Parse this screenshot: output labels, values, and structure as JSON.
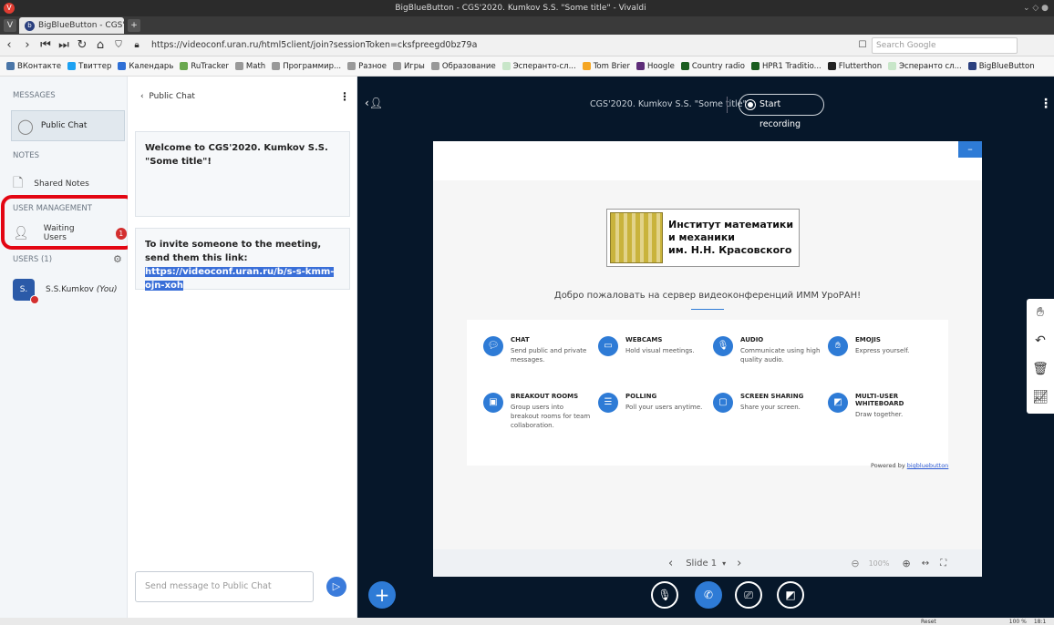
{
  "window": {
    "title": "BigBlueButton - CGS'2020. Kumkov S.S. \"Some title\" - Vivaldi"
  },
  "tabs": [
    {
      "label": "BigBlueButton - CGS'2020."
    }
  ],
  "address": {
    "url": "https://videoconf.uran.ru/html5client/join?sessionToken=cksfpreegd0bz79a",
    "search_placeholder": "Search Google"
  },
  "bookmarks": [
    {
      "label": "ВКонтакте",
      "color": "#4a76a8"
    },
    {
      "label": "Твиттер",
      "color": "#1da1f2"
    },
    {
      "label": "Календарь",
      "color": "#2e6fd6"
    },
    {
      "label": "RuTracker",
      "color": "#6aa84f"
    },
    {
      "label": "Math",
      "color": "#999999"
    },
    {
      "label": "Программир...",
      "color": "#999999"
    },
    {
      "label": "Разное",
      "color": "#999999"
    },
    {
      "label": "Игры",
      "color": "#999999"
    },
    {
      "label": "Образование",
      "color": "#999999"
    },
    {
      "label": "Эсперанто-сл...",
      "color": "#c8e6c9"
    },
    {
      "label": "Tom Brier",
      "color": "#f5a623"
    },
    {
      "label": "Hoogle",
      "color": "#5e2d79"
    },
    {
      "label": "Country radio",
      "color": "#1b5e20"
    },
    {
      "label": "HPR1 Traditio...",
      "color": "#1b5e20"
    },
    {
      "label": "Flutterthon",
      "color": "#222222"
    },
    {
      "label": "Эсперанто сл...",
      "color": "#c8e6c9"
    },
    {
      "label": "BigBlueButton",
      "color": "#2a3f7e"
    }
  ],
  "sidebar": {
    "messages_title": "MESSAGES",
    "public_chat": "Public Chat",
    "notes_title": "NOTES",
    "shared_notes": "Shared Notes",
    "user_mgmt_title": "USER MANAGEMENT",
    "waiting_users": "Waiting Users",
    "waiting_count": "1",
    "users_title": "USERS (1)",
    "user_avatar": "S.",
    "user_name": "S.S.Kumkov",
    "user_you": "(You)"
  },
  "chat": {
    "header": "Public Chat",
    "welcome_msg": "Welcome to CGS'2020. Kumkov S.S. \"Some title\"!",
    "invite_msg": "To invite someone to the meeting, send them this link: ",
    "invite_link": "https://videoconf.uran.ru/b/s-s-kmm-ojn-xoh",
    "input_placeholder": "Send message to Public Chat"
  },
  "main": {
    "meeting_title": "CGS'2020. Kumkov S.S. \"Some title\"",
    "record_label": "Start recording",
    "logo_text": [
      "Институт математики",
      "и механики",
      "им. Н.Н. Красовского"
    ],
    "welcome": "Добро пожаловать на сервер видеоконференций ИММ УроРАН!",
    "features": [
      {
        "title": "CHAT",
        "desc": "Send public and private messages."
      },
      {
        "title": "WEBCAMS",
        "desc": "Hold visual meetings."
      },
      {
        "title": "AUDIO",
        "desc": "Communicate using high quality audio."
      },
      {
        "title": "EMOJIS",
        "desc": "Express yourself."
      },
      {
        "title": "BREAKOUT ROOMS",
        "desc": "Group users into breakout rooms for team collaboration."
      },
      {
        "title": "POLLING",
        "desc": "Poll your users anytime."
      },
      {
        "title": "SCREEN SHARING",
        "desc": "Share your screen."
      },
      {
        "title": "MULTI-USER WHITEBOARD",
        "desc": "Draw together."
      }
    ],
    "powered_prefix": "Powered by ",
    "powered_link": "bigbluebutton",
    "slide_label": "Slide 1",
    "zoom": "100%"
  },
  "status": {
    "reset": "Reset",
    "zoom": "100 %",
    "time": "18:1"
  }
}
